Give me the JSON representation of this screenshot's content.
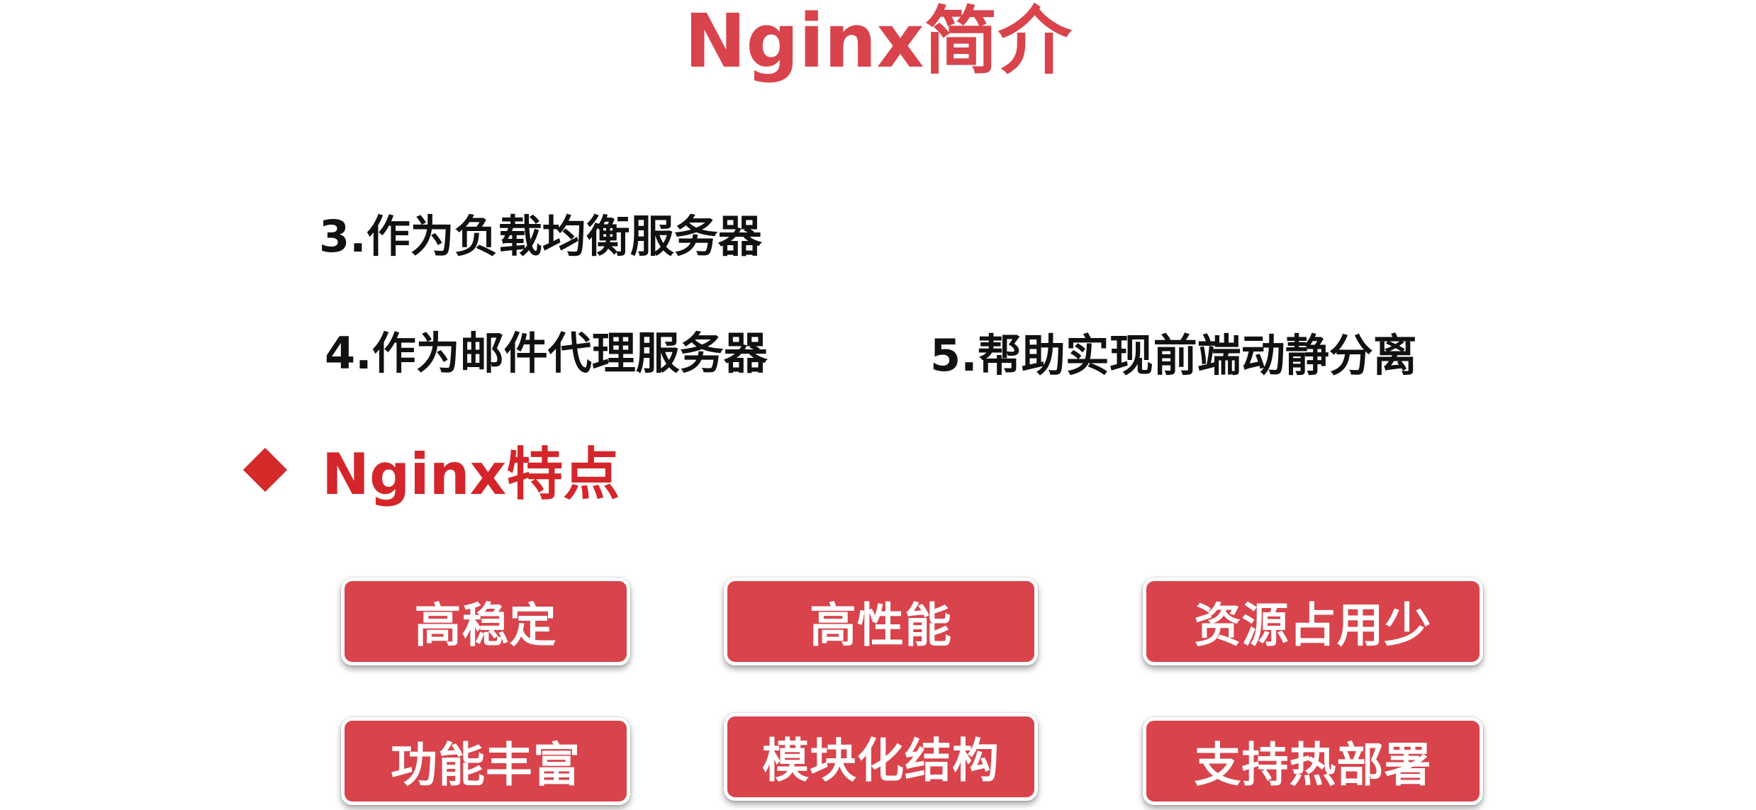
{
  "title": "Nginx简介",
  "uses": [
    "3.作为负载均衡服务器",
    "4.作为邮件代理服务器",
    "5.帮助实现前端动静分离"
  ],
  "section": {
    "bullet_icon": "diamond-bullet-icon",
    "heading": "Nginx特点"
  },
  "features": [
    "高稳定",
    "高性能",
    "资源占用少",
    "功能丰富",
    "模块化结构",
    "支持热部署"
  ],
  "colors": {
    "accent_red": "#d9434b",
    "heading_red": "#d4262a",
    "text": "#111111",
    "background": "#ffffff"
  }
}
